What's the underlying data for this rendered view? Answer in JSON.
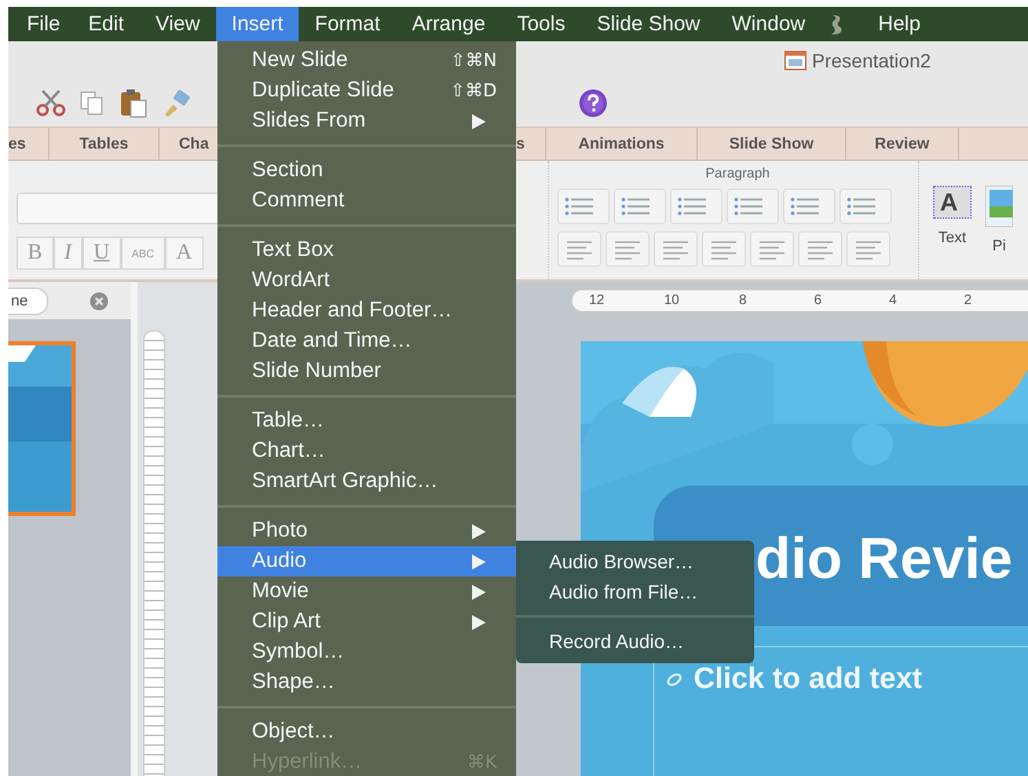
{
  "menu_bar": {
    "items": [
      {
        "kind": "text",
        "label": "File",
        "selected": false
      },
      {
        "kind": "text",
        "label": "Edit",
        "selected": false
      },
      {
        "kind": "text",
        "label": "View",
        "selected": false
      },
      {
        "kind": "text",
        "label": "Insert",
        "selected": true
      },
      {
        "kind": "text",
        "label": "Format",
        "selected": false
      },
      {
        "kind": "text",
        "label": "Arrange",
        "selected": false
      },
      {
        "kind": "text",
        "label": "Tools",
        "selected": false
      },
      {
        "kind": "text",
        "label": "Slide Show",
        "selected": false
      },
      {
        "kind": "text",
        "label": "Window",
        "selected": false
      },
      {
        "kind": "icon",
        "selected": false
      },
      {
        "kind": "text",
        "label": "Help",
        "selected": false
      }
    ]
  },
  "toolbar": {
    "document_title": "Presentation2"
  },
  "ribbon": {
    "tabs_left": [
      "es",
      "Tables",
      "Cha"
    ],
    "tabs_right": [
      "s",
      "Animations",
      "Slide Show",
      "Review"
    ],
    "format_buttons": [
      "B",
      "I",
      "U",
      "ABC",
      "A"
    ],
    "paragraph_group": {
      "label": "Paragraph"
    },
    "text_button": {
      "glyph": "A",
      "label": "Text"
    },
    "picture_button": {
      "label": "Pi"
    }
  },
  "thumbnails_pane": {
    "search": {
      "value": "ne"
    },
    "slides": [
      {
        "selected": true
      }
    ]
  },
  "ruler": {
    "labels": [
      "12",
      "10",
      "8",
      "6",
      "4",
      "2"
    ]
  },
  "slide": {
    "title": "dio Revie",
    "subtitle_placeholder": "Click to add text"
  },
  "insert_menu": {
    "groups": [
      [
        {
          "label": "New Slide",
          "shortcut": "⇧⌘N",
          "submenu": false,
          "selected": false,
          "disabled": false
        },
        {
          "label": "Duplicate Slide",
          "shortcut": "⇧⌘D",
          "submenu": false,
          "selected": false,
          "disabled": false
        },
        {
          "label": "Slides From",
          "submenu": true,
          "selected": false,
          "disabled": false
        }
      ],
      [
        {
          "label": "Section",
          "submenu": false,
          "selected": false,
          "disabled": false
        },
        {
          "label": "Comment",
          "submenu": false,
          "selected": false,
          "disabled": false
        }
      ],
      [
        {
          "label": "Text Box",
          "submenu": false,
          "selected": false,
          "disabled": false
        },
        {
          "label": "WordArt",
          "submenu": false,
          "selected": false,
          "disabled": false
        },
        {
          "label": "Header and Footer…",
          "submenu": false,
          "selected": false,
          "disabled": false
        },
        {
          "label": "Date and Time…",
          "submenu": false,
          "selected": false,
          "disabled": false
        },
        {
          "label": "Slide Number",
          "submenu": false,
          "selected": false,
          "disabled": false
        }
      ],
      [
        {
          "label": "Table…",
          "submenu": false,
          "selected": false,
          "disabled": false
        },
        {
          "label": "Chart…",
          "submenu": false,
          "selected": false,
          "disabled": false
        },
        {
          "label": "SmartArt Graphic…",
          "submenu": false,
          "selected": false,
          "disabled": false
        }
      ],
      [
        {
          "label": "Photo",
          "submenu": true,
          "selected": false,
          "disabled": false
        },
        {
          "label": "Audio",
          "submenu": true,
          "selected": true,
          "disabled": false
        },
        {
          "label": "Movie",
          "submenu": true,
          "selected": false,
          "disabled": false
        },
        {
          "label": "Clip Art",
          "submenu": true,
          "selected": false,
          "disabled": false
        },
        {
          "label": "Symbol…",
          "submenu": false,
          "selected": false,
          "disabled": false
        },
        {
          "label": "Shape…",
          "submenu": false,
          "selected": false,
          "disabled": false
        }
      ],
      [
        {
          "label": "Object…",
          "submenu": false,
          "selected": false,
          "disabled": false
        },
        {
          "label": "Hyperlink…",
          "shortcut": "⌘K",
          "submenu": false,
          "selected": false,
          "disabled": true
        }
      ]
    ]
  },
  "audio_submenu": {
    "groups": [
      [
        {
          "label": "Audio Browser…"
        },
        {
          "label": "Audio from File…"
        }
      ],
      [
        {
          "label": "Record Audio…"
        }
      ]
    ]
  }
}
